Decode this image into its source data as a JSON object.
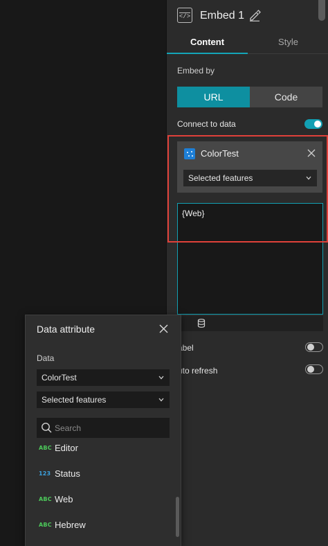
{
  "panel": {
    "widget_icon_glyph": "</>",
    "title": "Embed 1",
    "tabs": [
      {
        "label": "Content",
        "active": true
      },
      {
        "label": "Style",
        "active": false
      }
    ],
    "embed_by": {
      "label": "Embed by",
      "options": [
        "URL",
        "Code"
      ],
      "selected": "URL"
    },
    "connect_to_data": {
      "label": "Connect to data",
      "enabled": true
    },
    "data_source": {
      "name": "ColorTest",
      "view": "Selected features"
    },
    "url_value": "{Web}",
    "label_row": {
      "label": "Label",
      "visible_text": "abel",
      "enabled": false
    },
    "auto_refresh": {
      "label": "Auto refresh",
      "visible_text": "uto refresh",
      "enabled": false
    }
  },
  "popover": {
    "title": "Data attribute",
    "data_label": "Data",
    "data_source": "ColorTest",
    "view": "Selected features",
    "search_placeholder": "Search",
    "fields": [
      {
        "type": "ABC",
        "name": "Editor",
        "type_color": "#4cc95a"
      },
      {
        "type": "123",
        "name": "Status",
        "type_color": "#3ba2e0"
      },
      {
        "type": "ABC",
        "name": "Web",
        "type_color": "#4cc95a"
      },
      {
        "type": "ABC",
        "name": "Hebrew",
        "type_color": "#4cc95a"
      }
    ]
  },
  "colors": {
    "accent": "#12a0b3",
    "highlight": "#e0413a",
    "panel_bg": "#2b2b2b",
    "canvas_bg": "#181818"
  },
  "icons": [
    "code-widget-icon",
    "pencil-icon",
    "close-icon",
    "chevron-down-icon",
    "database-icon",
    "search-icon",
    "layer-icon"
  ]
}
